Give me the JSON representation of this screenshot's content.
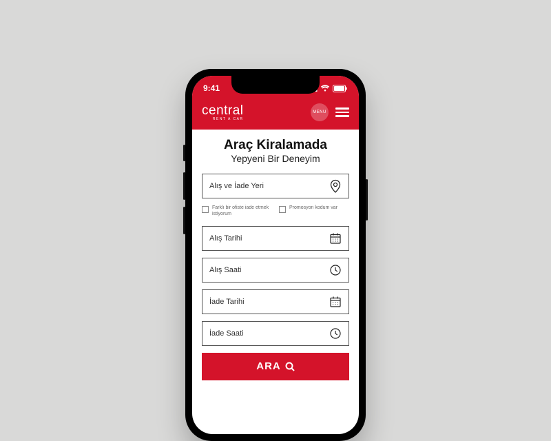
{
  "status": {
    "time": "9:41"
  },
  "brand": {
    "name": "central",
    "tagline": "RENT A CAR"
  },
  "menu": {
    "label": "MENU"
  },
  "hero": {
    "title": "Araç Kiralamada",
    "subtitle": "Yepyeni Bir Deneyim"
  },
  "fields": {
    "location": "Alış ve İade Yeri",
    "pickup_date": "Alış Tarihi",
    "pickup_time": "Alış Saati",
    "return_date": "İade Tarihi",
    "return_time": "İade Saati"
  },
  "checks": {
    "different_office": "Farklı bir ofiste iade etmek istiyorum",
    "promo": "Promosyon kodum var"
  },
  "search": {
    "label": "ARA"
  },
  "colors": {
    "brand": "#d4132a"
  }
}
